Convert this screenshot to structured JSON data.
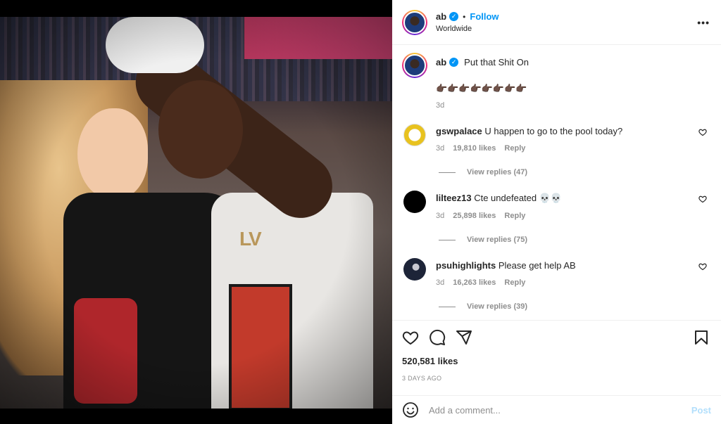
{
  "header": {
    "username": "ab",
    "follow_label": "Follow",
    "dot": "•",
    "location": "Worldwide",
    "more": "•••"
  },
  "caption": {
    "username": "ab",
    "text": "Put that Shit On",
    "emojis": "👉🏿👉🏿👉🏿👉🏿👉🏿👉🏿👉🏿👉🏿",
    "time": "3d"
  },
  "comments": [
    {
      "username": "gswpalace",
      "text": "U happen to go to the pool today?",
      "time": "3d",
      "likes": "19,810 likes",
      "reply_label": "Reply",
      "view_replies": "View replies (47)",
      "avatar_color": "#e8c21f"
    },
    {
      "username": "lilteez13",
      "text": "Cte undefeated 💀💀",
      "time": "3d",
      "likes": "25,898 likes",
      "reply_label": "Reply",
      "view_replies": "View replies (75)",
      "avatar_color": "#000000"
    },
    {
      "username": "psuhighlights",
      "text": "Please get help AB",
      "time": "3d",
      "likes": "16,263 likes",
      "reply_label": "Reply",
      "view_replies": "View replies (39)",
      "avatar_color": "#1d2438"
    }
  ],
  "actions": {
    "likes": "520,581 likes",
    "date": "3 DAYS AGO"
  },
  "add_comment": {
    "placeholder": "Add a comment...",
    "post_label": "Post"
  },
  "colors": {
    "accent": "#0095f6",
    "muted": "#8e8e8e",
    "post_disabled": "#b2dffc"
  }
}
